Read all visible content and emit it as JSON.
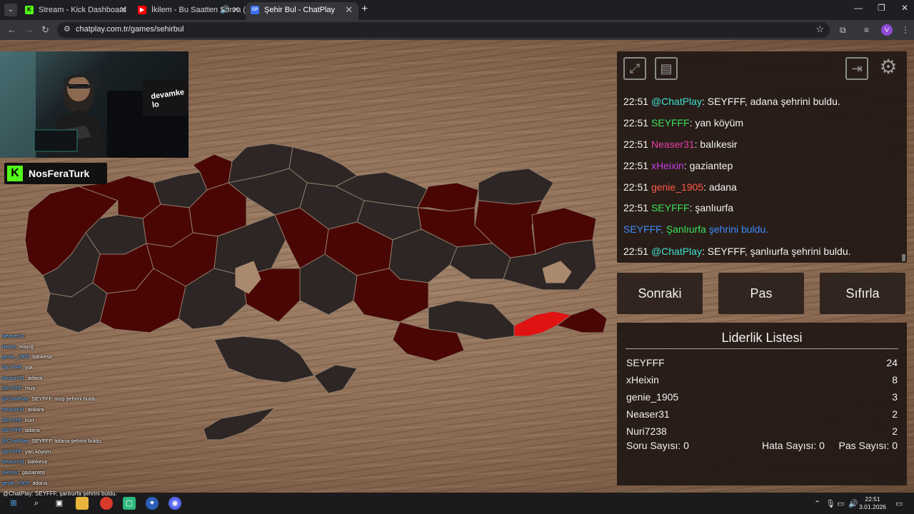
{
  "browser": {
    "tabs": [
      {
        "label": "Stream - Kick Dashboard",
        "icon": "kick-icon"
      },
      {
        "label": "İkilem - Bu Saatten Sonra (",
        "icon": "youtube-icon"
      },
      {
        "label": "Şehir Bul - ChatPlay",
        "icon": "chatplay-icon"
      }
    ],
    "url": "chatplay.com.tr/games/sehirbul",
    "profile_initial": "V"
  },
  "stream": {
    "streamer": "NosFeraTurk",
    "sign_text": "devamke lo"
  },
  "stream_chat": [
    {
      "user": "Neaser31",
      "text": ""
    },
    {
      "user": "Heixin",
      "text": "elazığ"
    },
    {
      "user": "genie_1905",
      "text": "balıkesir"
    },
    {
      "user": "SEYFFF",
      "text": "yok"
    },
    {
      "user": "Neaser31",
      "text": "adana"
    },
    {
      "user": "SEYFFF",
      "text": "muş"
    },
    {
      "user": "@ChatPlay",
      "text": "SEYFFF, muş şehrini buldu."
    },
    {
      "user": "Neaser31",
      "text": "ankara"
    },
    {
      "user": "SEYFFF",
      "text": "kürt"
    },
    {
      "user": "SEYFFF",
      "text": "adana"
    },
    {
      "user": "@ChatPlay",
      "text": "SEYFFF, adana şehrini buldu."
    },
    {
      "user": "SEYFFF",
      "text": "yan köyüm"
    },
    {
      "user": "Neaser31",
      "text": "balıkesir"
    },
    {
      "user": "xHeixin",
      "text": "gaziantep"
    },
    {
      "user": "genie_1905",
      "text": "adana"
    },
    {
      "user": "SEYFFF",
      "text": "şanlıurfa"
    }
  ],
  "stream_chat_last": "@ChatPlay: SEYFFF, şanlıurfa şehrini buldu.",
  "game_chat": [
    {
      "time": "22:51",
      "user": "@ChatPlay",
      "text": ": SEYFFF, adana şehrini buldu.",
      "kind": "c-cp"
    },
    {
      "time": "22:51",
      "user": "SEYFFF",
      "text": ": yan köyüm",
      "kind": "c-sey"
    },
    {
      "time": "22:51",
      "user": "Neaser31",
      "text": ": balıkesir",
      "kind": "c-nea"
    },
    {
      "time": "22:51",
      "user": "xHeixin",
      "text": ": gaziantep",
      "kind": "c-xh"
    },
    {
      "time": "22:51",
      "user": "genie_1905",
      "text": ": adana",
      "kind": "c-gen"
    },
    {
      "time": "22:51",
      "user": "SEYFFF",
      "text": ": şanlıurfa",
      "kind": "c-sey"
    }
  ],
  "system_message": {
    "user": "SEYFFF,",
    "city": "Şanlıurfa",
    "text": "şehrini buldu."
  },
  "last_message": {
    "time": "22:51",
    "user": "@ChatPlay",
    "text": ": SEYFFF, şanlıurfa şehrini buldu."
  },
  "buttons": {
    "next": "Sonraki",
    "pass": "Pas",
    "reset": "Sıfırla"
  },
  "leaderboard": {
    "title": "Liderlik Listesi",
    "rows": [
      {
        "name": "SEYFFF",
        "score": "24"
      },
      {
        "name": "xHeixin",
        "score": "8"
      },
      {
        "name": "genie_1905",
        "score": "3"
      },
      {
        "name": "Neaser31",
        "score": "2"
      },
      {
        "name": "Nuri7238",
        "score": "2"
      }
    ],
    "question_count": "Soru Sayısı: 0",
    "error_count": "Hata Sayısı: 0",
    "pass_count": "Pas Sayısı: 0"
  },
  "map": {
    "found_fill": "#4a0604",
    "unfound_fill": "#2e2624",
    "highlight_fill": "#e01212"
  },
  "taskbar": {
    "time": "22:51",
    "date": "3.01.2026"
  }
}
